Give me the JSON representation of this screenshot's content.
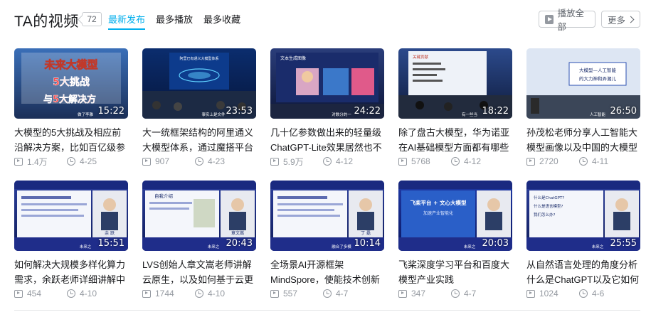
{
  "header": {
    "title": "TA的视频",
    "count": "72",
    "tabs": [
      {
        "label": "最新发布",
        "active": true
      },
      {
        "label": "最多播放",
        "active": false
      },
      {
        "label": "最多收藏",
        "active": false
      }
    ],
    "play_all_label": "播放全部",
    "more_label": "更多"
  },
  "colors": {
    "accent": "#00aeec",
    "text": "#18191c",
    "muted": "#9499a0"
  },
  "videos": [
    {
      "title": "大模型的5大挑战及相应前沿解决方案，比如百亿级参数大",
      "duration": "15:22",
      "views": "1.4万",
      "date": "4-25",
      "thumb_text": [
        "未来大模型",
        "5大挑战",
        "与5大解决方"
      ],
      "thumb_caption": "做了李雅"
    },
    {
      "title": "大一统框架结构的阿里通义大模型体系，通过魔搭平台支持",
      "duration": "23:53",
      "views": "907",
      "date": "4-23",
      "thumb_text": [
        "阿里已有通义大模型体系"
      ],
      "thumb_caption": "事实上是文件"
    },
    {
      "title": "几十亿参数做出来的轻量级ChatGPT-Lite效果居然也不",
      "duration": "24:22",
      "views": "5.9万",
      "date": "4-12",
      "thumb_text": [
        "文本生成图像"
      ],
      "thumb_caption": "对数分的一"
    },
    {
      "title": "除了盘古大模型，华为诺亚在AI基础模型方面都有哪些研究",
      "duration": "18:22",
      "views": "5768",
      "date": "4-12",
      "thumb_text": [
        "关键贡献"
      ],
      "thumb_caption": "有一些当"
    },
    {
      "title": "孙茂松老师分享人工智能大模型画像以及中国的大模型应该",
      "duration": "26:50",
      "views": "2720",
      "date": "4-11",
      "thumb_text": [
        "大模型—人工智能",
        "的大力神和弄潮儿"
      ],
      "thumb_caption": "人工智能"
    },
    {
      "title": "如何解决大规模多样化算力需求，余跃老师详细讲解中国算",
      "duration": "15:51",
      "views": "454",
      "date": "4-10",
      "thumb_text": [
        "余 跃"
      ],
      "thumb_caption": "未来之"
    },
    {
      "title": "LVS创始人章文嵩老师讲解云原生，以及如何基于云更好的",
      "duration": "20:43",
      "views": "1744",
      "date": "4-10",
      "thumb_text": [
        "自我介绍",
        "章文嵩"
      ],
      "thumb_caption": "未来之"
    },
    {
      "title": "全场景AI开源框架MindSpore，使能技术创新与",
      "duration": "10:14",
      "views": "557",
      "date": "4-7",
      "thumb_text": [
        "丁 磊"
      ],
      "thumb_caption": "融合了多模"
    },
    {
      "title": "飞桨深度学习平台和百度大模型产业实践",
      "duration": "20:03",
      "views": "347",
      "date": "4-7",
      "thumb_text": [
        "飞桨平台 + 文心大模型",
        "加速产业智能化"
      ],
      "thumb_caption": "未来之"
    },
    {
      "title": "从自然语言处理的角度分析什么是ChatGPT以及它如何工",
      "duration": "25:55",
      "views": "1024",
      "date": "4-6",
      "thumb_text": [
        "什么是ChatGPT?",
        "什么是语言模型?",
        "我们怎么办?"
      ],
      "thumb_caption": "未来之"
    }
  ]
}
